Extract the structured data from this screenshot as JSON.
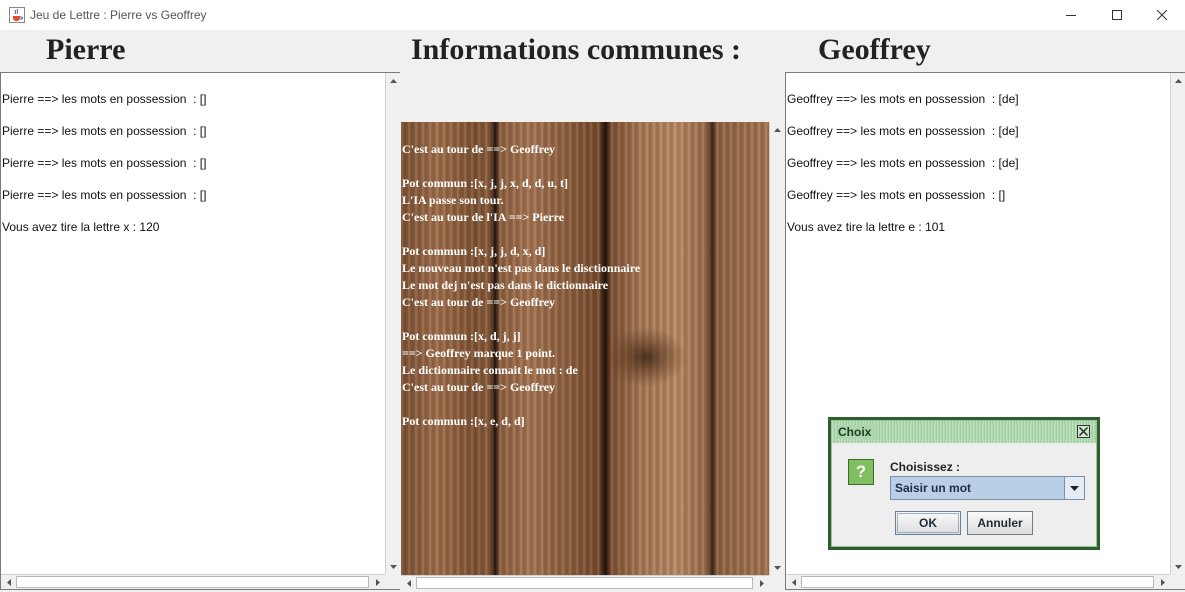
{
  "window": {
    "title": "Jeu de Lettre : Pierre vs Geoffrey",
    "icon": "java-cup-icon"
  },
  "headers": {
    "left": "Pierre",
    "center": "Informations communes :",
    "right": "Geoffrey"
  },
  "left_panel": {
    "lines": [
      "Pierre ==> les mots en possession  : []",
      "Pierre ==> les mots en possession  : []",
      "Pierre ==> les mots en possession  : []",
      "Pierre ==> les mots en possession  : []",
      "Vous avez tire la lettre x : 120"
    ]
  },
  "center_panel": {
    "lines": [
      "C'est au tour de ==> Geoffrey",
      "",
      "Pot commun :[x, j, j, x, d, d, u, t]",
      "L'IA passe son tour.",
      "C'est au tour de l'IA ==> Pierre",
      "",
      "Pot commun :[x, j, j, d, x, d]",
      "Le nouveau mot n'est pas dans le disctionnaire",
      "Le mot dej n'est pas dans le dictionnaire",
      "C'est au tour de ==> Geoffrey",
      "",
      "Pot commun :[x, d, j, j]",
      "==> Geoffrey marque 1 point.",
      "Le dictionnaire connait le mot : de",
      "C'est au tour de ==> Geoffrey",
      "",
      "Pot commun :[x, e, d, d]"
    ]
  },
  "right_panel": {
    "lines": [
      "Geoffrey ==> les mots en possession  : [de]",
      "Geoffrey ==> les mots en possession  : [de]",
      "Geoffrey ==> les mots en possession  : [de]",
      "Geoffrey ==> les mots en possession  : []",
      "Vous avez tire la lettre e : 101"
    ]
  },
  "dialog": {
    "title": "Choix",
    "prompt": "Choisissez :",
    "selected_option": "Saisir un mot",
    "ok_label": "OK",
    "cancel_label": "Annuler"
  }
}
